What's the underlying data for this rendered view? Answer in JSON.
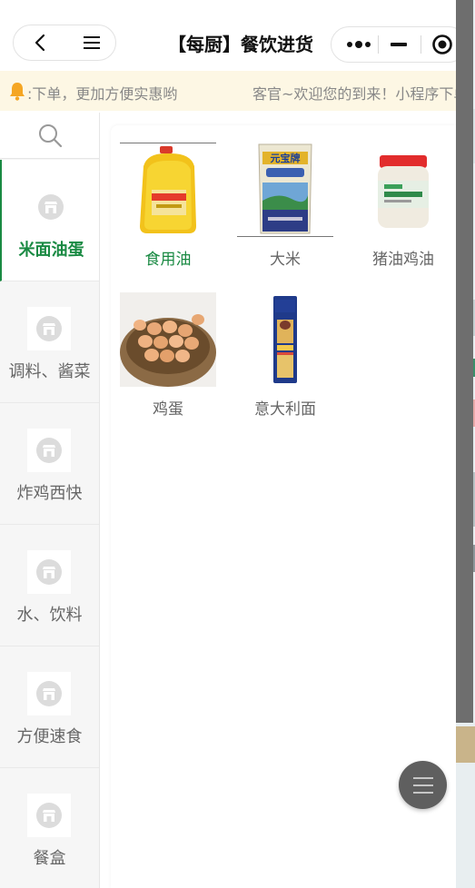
{
  "header": {
    "title": "【每厨】餐饮进货",
    "back_icon": "chevron-left-icon",
    "menu_icon": "hamburger-icon",
    "more_icon": "more-dots-icon",
    "minimize_icon": "minus-icon",
    "close_icon": "target-circle-icon"
  },
  "notice": {
    "icon": "bell-icon",
    "text_primary": ":下单，更加方便实惠哟",
    "text_secondary": "客官~欢迎您的到来！小程序下单"
  },
  "sidebar": {
    "search_icon": "search-icon",
    "categories": [
      {
        "label": "米面油蛋",
        "active": true
      },
      {
        "label": "调料、酱菜",
        "active": false
      },
      {
        "label": "炸鸡西快",
        "active": false
      },
      {
        "label": "水、饮料",
        "active": false
      },
      {
        "label": "方便速食",
        "active": false
      },
      {
        "label": "餐盒",
        "active": false
      }
    ]
  },
  "products": [
    {
      "name": "食用油",
      "active": true,
      "image": "oil-bottle"
    },
    {
      "name": "大米",
      "active": false,
      "image": "rice-bag"
    },
    {
      "name": "猪油鸡油",
      "active": false,
      "image": "lard-jar"
    },
    {
      "name": "鸡蛋",
      "active": false,
      "image": "egg-basket"
    },
    {
      "name": "意大利面",
      "active": false,
      "image": "spaghetti-pack"
    }
  ],
  "fab": {
    "icon": "hamburger-icon"
  },
  "colors": {
    "accent": "#1a8a43",
    "notice_bg": "#fdf7e4",
    "bell": "#f5a623",
    "fab": "#5f5f5f"
  }
}
